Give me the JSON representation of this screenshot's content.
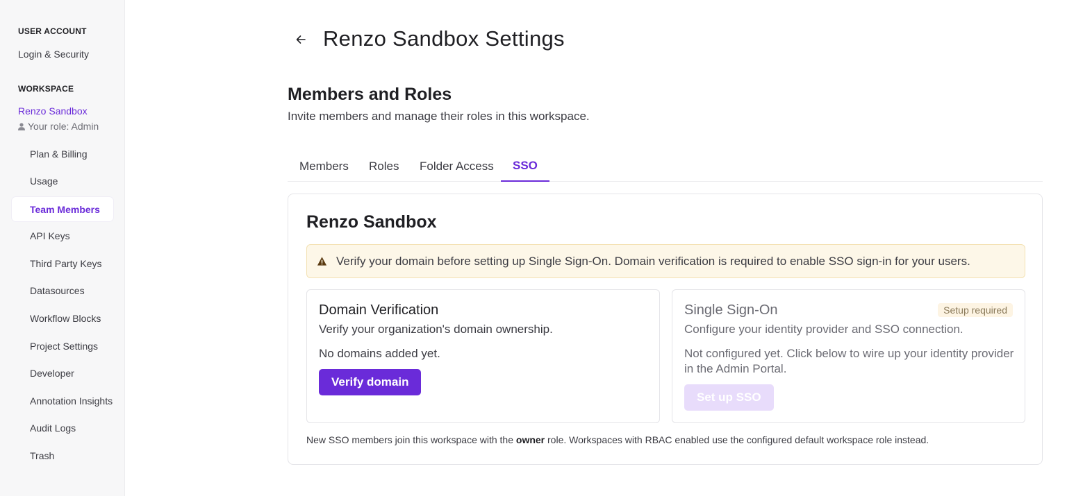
{
  "sidebar": {
    "user_account_title": "User account",
    "login_security": "Login & Security",
    "workspace_title": "Workspace",
    "workspace_name": "Renzo Sandbox",
    "role_label": "Your role: Admin",
    "items": [
      {
        "label": "Plan & Billing"
      },
      {
        "label": "Usage"
      },
      {
        "label": "Team Members"
      },
      {
        "label": "API Keys"
      },
      {
        "label": "Third Party Keys"
      },
      {
        "label": "Datasources"
      },
      {
        "label": "Workflow Blocks"
      },
      {
        "label": "Project Settings"
      },
      {
        "label": "Developer"
      },
      {
        "label": "Annotation Insights"
      },
      {
        "label": "Audit Logs"
      },
      {
        "label": "Trash"
      }
    ],
    "active_item": "Team Members"
  },
  "header": {
    "back_icon": "arrow-left-icon",
    "title": "Renzo Sandbox Settings"
  },
  "section": {
    "title": "Members and Roles",
    "subtitle": "Invite members and manage their roles in this workspace."
  },
  "tabs": [
    {
      "label": "Members"
    },
    {
      "label": "Roles"
    },
    {
      "label": "Folder Access"
    },
    {
      "label": "SSO"
    }
  ],
  "active_tab": "SSO",
  "card": {
    "title": "Renzo Sandbox",
    "alert": "Verify your domain before setting up Single Sign-On. Domain verification is required to enable SSO sign-in for your users.",
    "domain": {
      "title": "Domain Verification",
      "subtitle": "Verify your organization's domain ownership.",
      "empty": "No domains added yet.",
      "button": "Verify domain"
    },
    "sso": {
      "title": "Single Sign-On",
      "badge": "Setup required",
      "subtitle": "Configure your identity provider and SSO connection.",
      "body": "Not configured yet. Click below to wire up your identity provider in the Admin Portal.",
      "button": "Set up SSO"
    },
    "footnote_pre": "New SSO members join this workspace with the",
    "footnote_bold": "owner",
    "footnote_post": "role. Workspaces with RBAC enabled use the configured default workspace role instead."
  },
  "colors": {
    "accent": "#6a2bd9",
    "alert_bg": "#fdf7e8",
    "alert_icon": "#5a3a10"
  }
}
